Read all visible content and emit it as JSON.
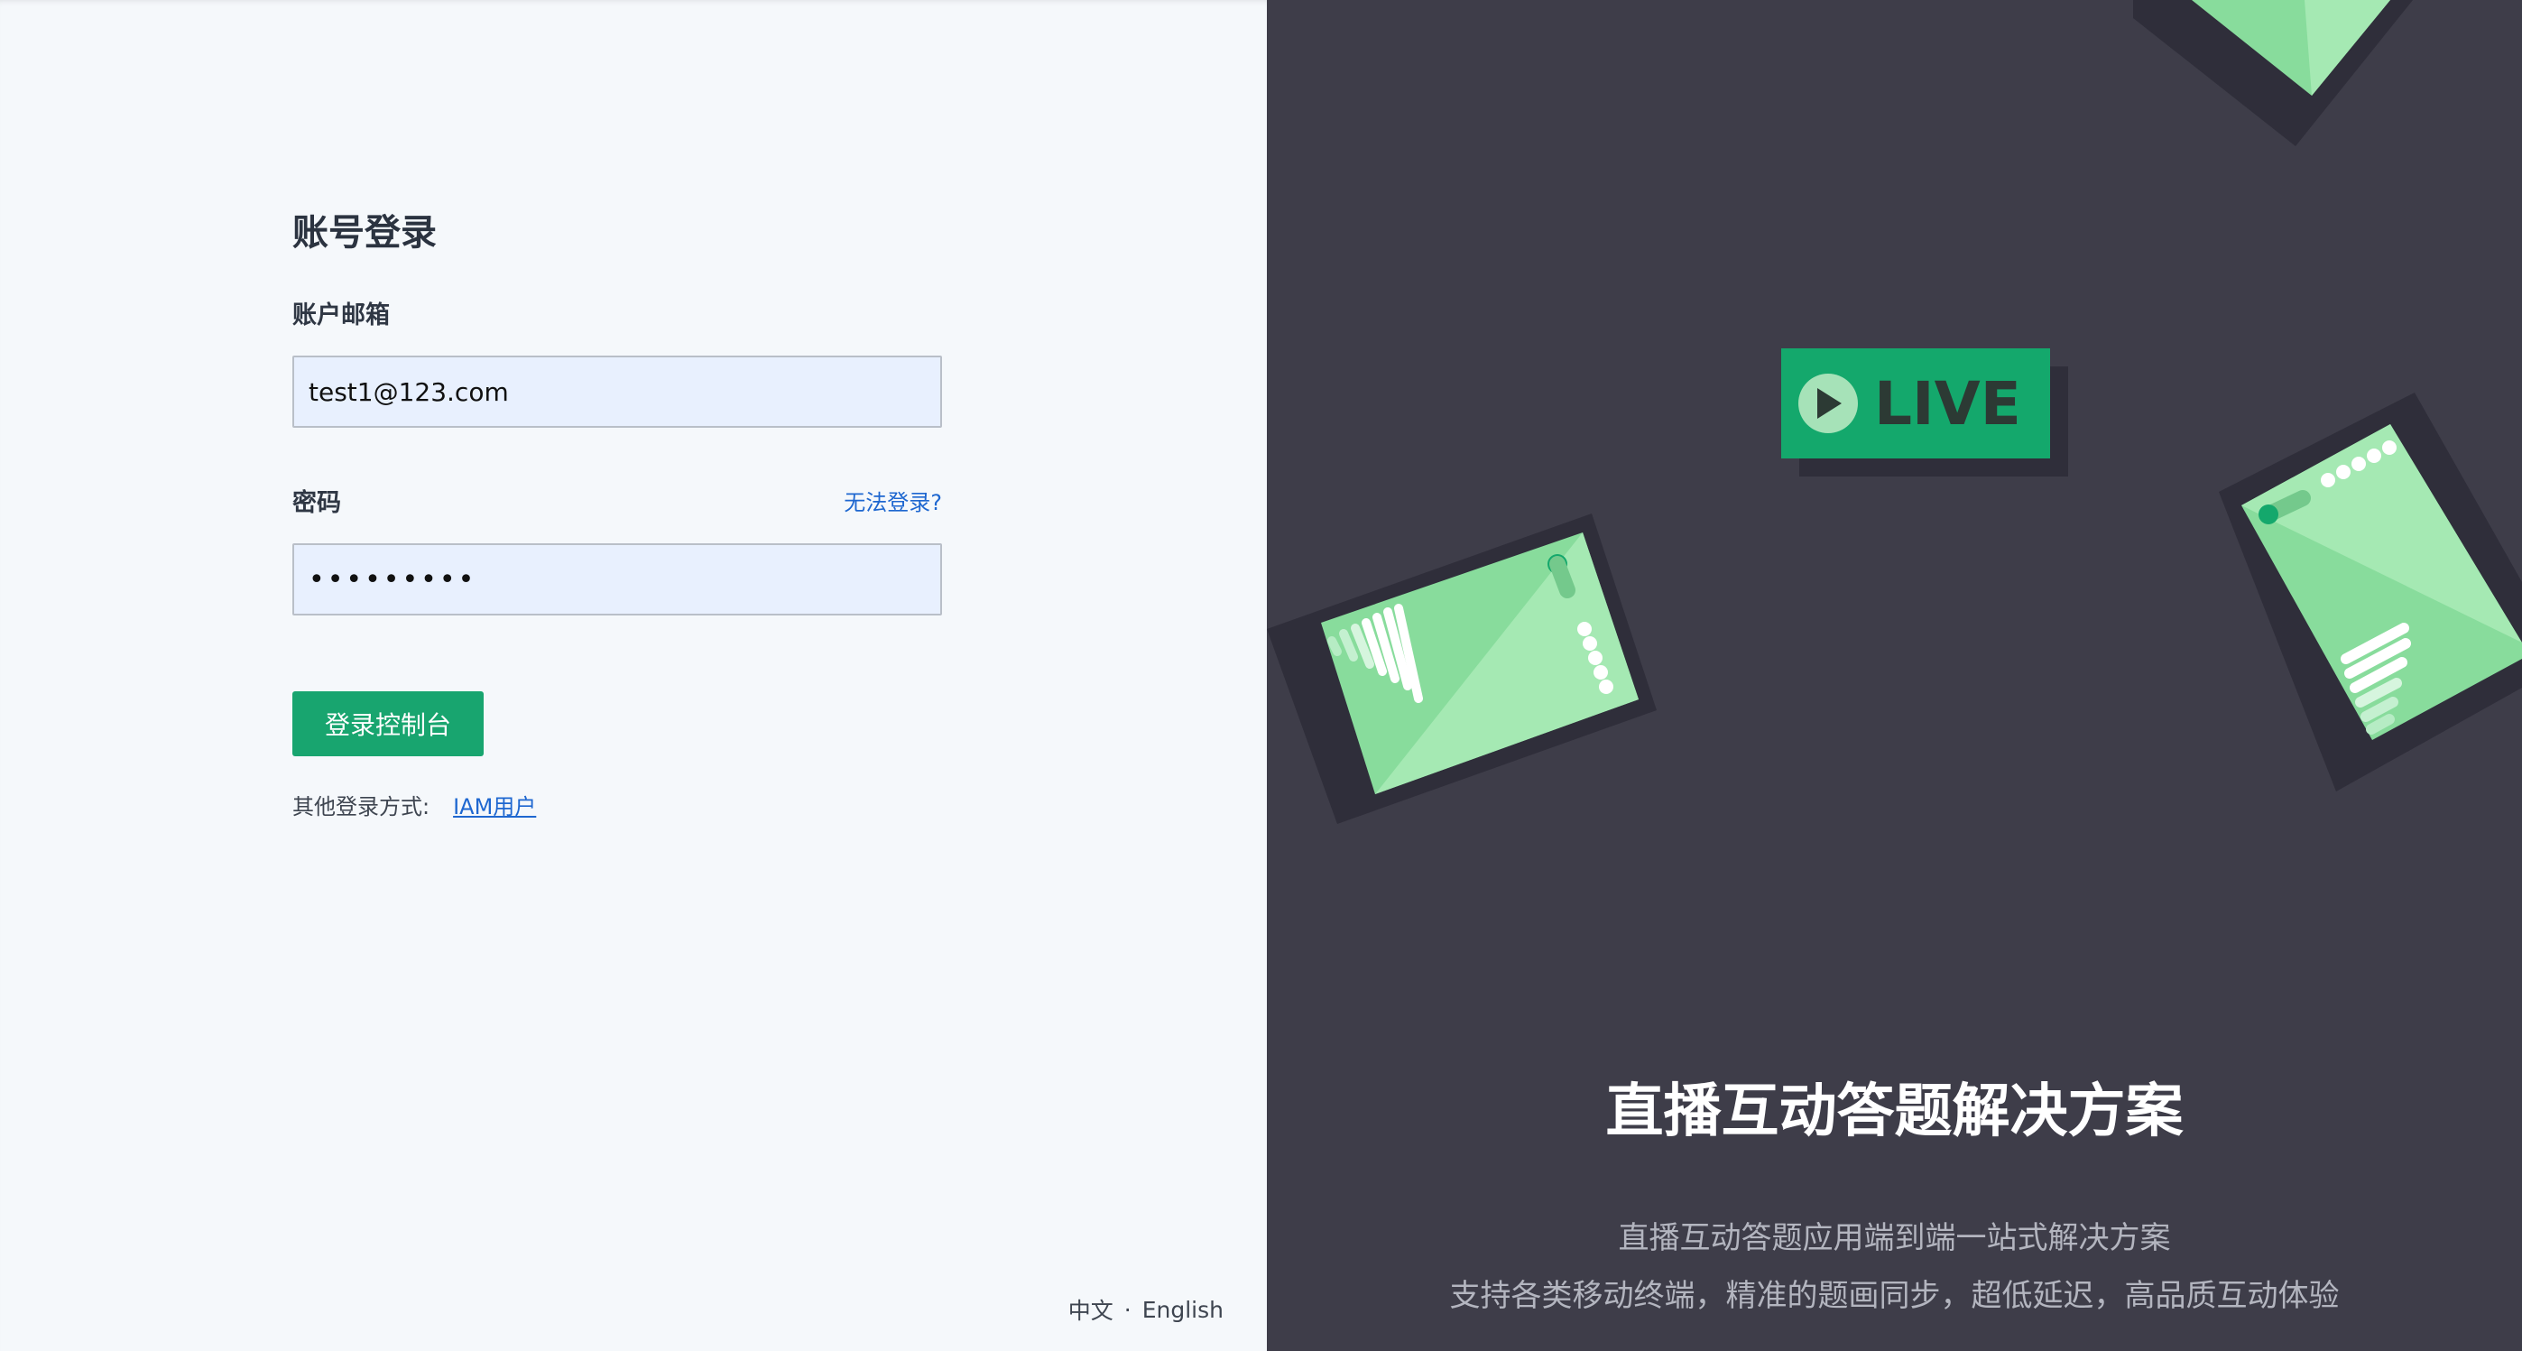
{
  "login": {
    "title": "账号登录",
    "email_label": "账户邮箱",
    "email_value": "test1@123.com",
    "password_label": "密码",
    "forgot_link": "无法登录?",
    "password_value": "•••••••••",
    "submit_label": "登录控制台",
    "other_login_label": "其他登录方式:",
    "iam_link": "IAM用户"
  },
  "language": {
    "chinese": "中文",
    "separator": "·",
    "english": "English"
  },
  "promo": {
    "badge_text": "LIVE",
    "title": "直播互动答题解决方案",
    "line1": "直播互动答题应用端到端一站式解决方案",
    "line2": "支持各类移动终端，精准的题画同步，超低延迟，高品质互动体验"
  },
  "colors": {
    "primary_green": "#18a56f",
    "link_blue": "#1e67d0",
    "dark_panel": "#3e3d49",
    "light_panel": "#f5f8fb",
    "input_fill": "#e8f0fe"
  },
  "icons": {
    "play": "play-icon"
  }
}
